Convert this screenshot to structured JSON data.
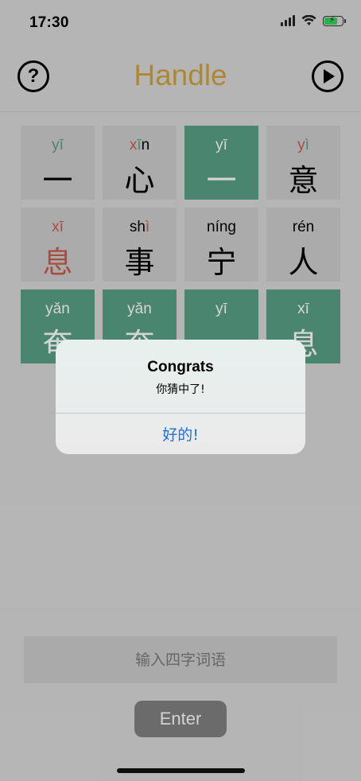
{
  "status_bar": {
    "time": "17:30",
    "icons": [
      "signal-icon",
      "wifi-icon",
      "battery-charging-icon"
    ]
  },
  "header": {
    "title": "Handle",
    "help_icon": "question-mark-icon",
    "play_icon": "play-icon",
    "title_color": "#c89a3b"
  },
  "colors": {
    "correct": "#54987f",
    "present": "#c0584b",
    "absent_tile": "#c3c3c3"
  },
  "grid": [
    [
      {
        "pinyin": "yī",
        "hanzi": "一",
        "tile": "gray",
        "hanzi_color": "black",
        "py_parts": [
          {
            "t": "y",
            "c": "green"
          },
          {
            "t": "ī",
            "c": "green"
          }
        ]
      },
      {
        "pinyin": "xīn",
        "hanzi": "心",
        "tile": "gray",
        "hanzi_color": "black",
        "py_parts": [
          {
            "t": "x",
            "c": "red"
          },
          {
            "t": "ī",
            "c": "green"
          },
          {
            "t": "n",
            "c": "black"
          }
        ]
      },
      {
        "pinyin": "yī",
        "hanzi": "一",
        "tile": "green",
        "hanzi_color": "white",
        "py_parts": [
          {
            "t": "yī",
            "c": "white"
          }
        ]
      },
      {
        "pinyin": "yì",
        "hanzi": "意",
        "tile": "gray",
        "hanzi_color": "black",
        "py_parts": [
          {
            "t": "y",
            "c": "red"
          },
          {
            "t": "ì",
            "c": "green"
          }
        ]
      }
    ],
    [
      {
        "pinyin": "xī",
        "hanzi": "息",
        "tile": "gray",
        "hanzi_color": "red",
        "py_parts": [
          {
            "t": "xī",
            "c": "red"
          }
        ]
      },
      {
        "pinyin": "shì",
        "hanzi": "事",
        "tile": "gray",
        "hanzi_color": "black",
        "py_parts": [
          {
            "t": "sh",
            "c": "black"
          },
          {
            "t": "ì",
            "c": "red"
          }
        ]
      },
      {
        "pinyin": "níng",
        "hanzi": "宁",
        "tile": "gray",
        "hanzi_color": "black",
        "py_parts": [
          {
            "t": "níng",
            "c": "black"
          }
        ]
      },
      {
        "pinyin": "rén",
        "hanzi": "人",
        "tile": "gray",
        "hanzi_color": "black",
        "py_parts": [
          {
            "t": "rén",
            "c": "black"
          }
        ]
      }
    ],
    [
      {
        "pinyin": "yǎn",
        "hanzi": "奄",
        "tile": "green",
        "hanzi_color": "white",
        "py_parts": [
          {
            "t": "yǎn",
            "c": "white"
          }
        ]
      },
      {
        "pinyin": "yǎn",
        "hanzi": "奄",
        "tile": "green",
        "hanzi_color": "white",
        "py_parts": [
          {
            "t": "yǎn",
            "c": "white"
          }
        ]
      },
      {
        "pinyin": "yī",
        "hanzi": "一",
        "tile": "green",
        "hanzi_color": "white",
        "py_parts": [
          {
            "t": "yī",
            "c": "white"
          }
        ]
      },
      {
        "pinyin": "xī",
        "hanzi": "息",
        "tile": "green",
        "hanzi_color": "white",
        "py_parts": [
          {
            "t": "xī",
            "c": "white"
          }
        ]
      }
    ]
  ],
  "input": {
    "placeholder": "输入四字词语",
    "value": ""
  },
  "enter_button": {
    "label": "Enter"
  },
  "dialog": {
    "title": "Congrats",
    "message": "你猜中了!",
    "button": "好的!"
  }
}
